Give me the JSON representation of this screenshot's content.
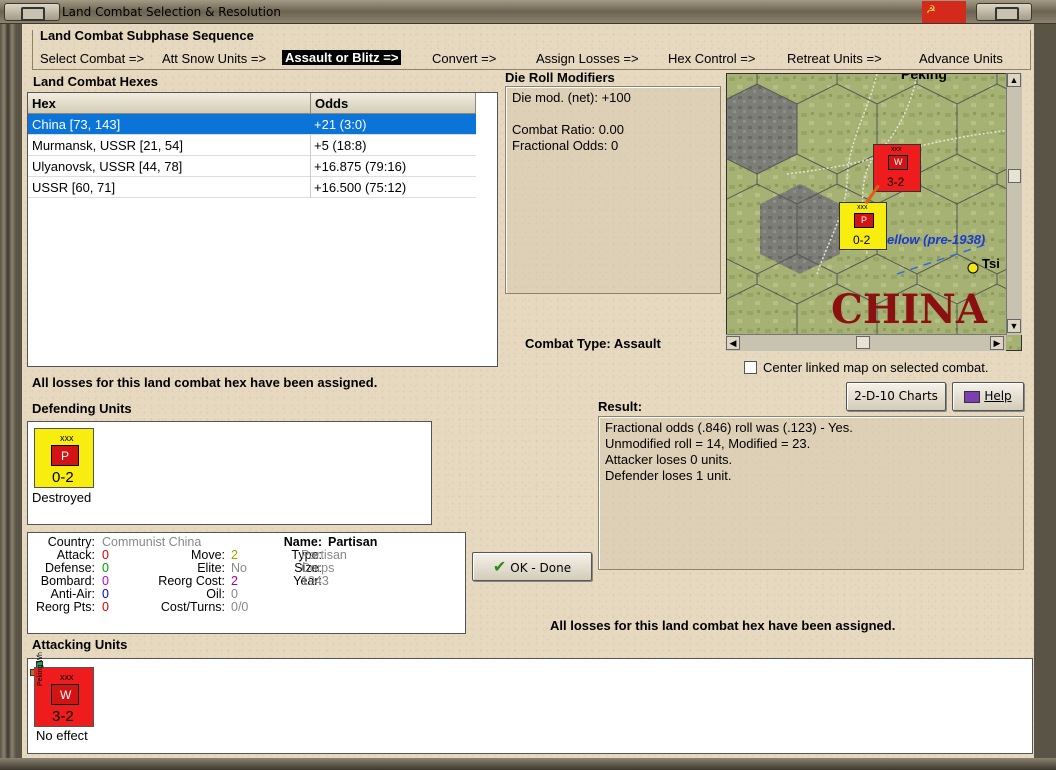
{
  "window": {
    "title": "Land Combat Selection & Resolution"
  },
  "subphase": {
    "title": "Land Combat Subphase Sequence",
    "steps": [
      "Select Combat =>",
      "Att Snow Units =>",
      "Assault or Blitz =>",
      "Convert =>",
      "Assign Losses =>",
      "Hex Control =>",
      "Retreat Units =>",
      "Advance Units"
    ],
    "active_step": "Assault or Blitz =>"
  },
  "hexes": {
    "title": "Land Combat Hexes",
    "columns": [
      "Hex",
      "Odds"
    ],
    "rows": [
      {
        "hex": "China [73, 143]",
        "odds": "+21 (3:0)",
        "selected": true
      },
      {
        "hex": "Murmansk, USSR [21, 54]",
        "odds": "+5 (18:8)",
        "selected": false
      },
      {
        "hex": "Ulyanovsk, USSR [44, 78]",
        "odds": "+16.875 (79:16)",
        "selected": false
      },
      {
        "hex": "USSR [60, 71]",
        "odds": "+16.500 (75:12)",
        "selected": false
      }
    ]
  },
  "die_roll": {
    "title": "Die Roll Modifiers",
    "lines": [
      "Die mod. (net): +100",
      "",
      "Combat Ratio: 0.00",
      "Fractional Odds: 0"
    ]
  },
  "map": {
    "region_label": "CHINA",
    "river_label": "ellow (pre-1938)",
    "city_label": "Tsi",
    "top_label": "Peking",
    "attacker_counter": {
      "factors": "3-2",
      "size": "xxx",
      "symbol": "W",
      "side_text": "Peking Wh"
    },
    "defender_counter": {
      "factors": "0-2",
      "size": "xxx",
      "symbol": "P"
    }
  },
  "combat_type": {
    "label": "Combat Type:",
    "value": "Assault"
  },
  "center_map": {
    "label": "Center linked map on selected combat.",
    "checked": false
  },
  "buttons": {
    "charts": "2-D-10 Charts",
    "help": "Help",
    "ok": "OK - Done"
  },
  "losses_message": "All losses for this land combat hex have been assigned.",
  "result": {
    "title": "Result:",
    "lines": [
      "Fractional odds (.846) roll was (.123)  - Yes.",
      "Unmodified roll = 14, Modified = 23.",
      "Attacker loses 0 units.",
      "Defender loses 1 unit."
    ]
  },
  "defending": {
    "title": "Defending Units",
    "units": [
      {
        "size": "xxx",
        "symbol": "P",
        "factors": "0-2",
        "status": "Destroyed"
      }
    ]
  },
  "attacking": {
    "title": "Attacking Units",
    "units": [
      {
        "size": "xxx",
        "symbol": "W",
        "factors": "3-2",
        "side_text": "Peking Wh",
        "status": "No effect"
      }
    ]
  },
  "unit_info": {
    "country_label": "Country:",
    "country": "Communist China",
    "attack_label": "Attack:",
    "attack": "0",
    "defense_label": "Defense:",
    "defense": "0",
    "bombard_label": "Bombard:",
    "bombard": "0",
    "antiair_label": "Anti-Air:",
    "antiair": "0",
    "reorg_pts_label": "Reorg Pts:",
    "reorg_pts": "0",
    "move_label": "Move:",
    "move": "2",
    "elite_label": "Elite:",
    "elite": "No",
    "reorg_cost_label": "Reorg Cost:",
    "reorg_cost": "2",
    "oil_label": "Oil:",
    "oil": "0",
    "cost_turns_label": "Cost/Turns:",
    "cost_turns": "0/0",
    "name_label": "Name:",
    "name": "Partisan",
    "type_label": "Type:",
    "type": "Partisan",
    "size_label": "Size:",
    "size": "Corps",
    "year_label": "Year:",
    "year": "1943"
  },
  "colors": {
    "selection": "#0a74d8",
    "attack": "#d00000",
    "defense": "#00a000",
    "bombard": "#c000c0",
    "antiair": "#0000d0",
    "move": "#a0a000",
    "reorg_cost": "#a000a0",
    "unit_red": "#ee1c1c",
    "unit_yellow": "#f7ee10",
    "china_label": "#8b1010"
  }
}
